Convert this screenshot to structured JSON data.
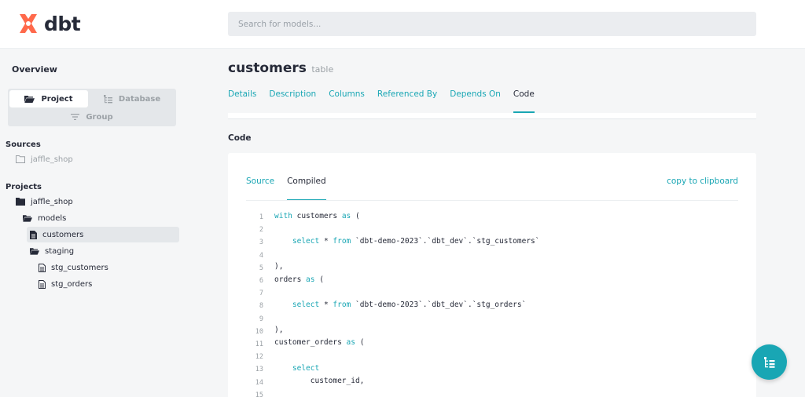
{
  "app": {
    "logo_text": "dbt",
    "brand_color": "#ff694b",
    "accent_color": "#19a6b4"
  },
  "search": {
    "placeholder": "Search for models..."
  },
  "sidebar": {
    "overview": "Overview",
    "switcher": {
      "project": "Project",
      "database": "Database",
      "group": "Group",
      "active": "Project"
    },
    "sources_title": "Sources",
    "sources": [
      {
        "label": "jaffle_shop",
        "icon": "folder-outline-icon"
      }
    ],
    "projects_title": "Projects",
    "projects": [
      {
        "label": "jaffle_shop",
        "icon": "folder-icon"
      },
      {
        "label": "models",
        "icon": "folder-icon"
      },
      {
        "label": "customers",
        "icon": "file-icon",
        "selected": true
      },
      {
        "label": "staging",
        "icon": "folder-icon"
      },
      {
        "label": "stg_customers",
        "icon": "file-outline-icon"
      },
      {
        "label": "stg_orders",
        "icon": "file-outline-icon"
      }
    ]
  },
  "main": {
    "title": "customers",
    "subtitle": "table",
    "tabs": [
      "Details",
      "Description",
      "Columns",
      "Referenced By",
      "Depends On",
      "Code"
    ],
    "active_tab": "Code",
    "code_heading": "Code",
    "code_tabs": [
      "Source",
      "Compiled"
    ],
    "active_code_tab": "Compiled",
    "copy_label": "copy to clipboard",
    "code_lines": [
      {
        "n": "1",
        "parts": [
          [
            "kw",
            "with"
          ],
          [
            "tx",
            " customers "
          ],
          [
            "kw",
            "as"
          ],
          [
            "tx",
            " ("
          ]
        ]
      },
      {
        "n": "2",
        "parts": []
      },
      {
        "n": "3",
        "parts": [
          [
            "tx",
            "    "
          ],
          [
            "kw",
            "select"
          ],
          [
            "tx",
            " * "
          ],
          [
            "kw",
            "from"
          ],
          [
            "tx",
            " `dbt-demo-2023`.`dbt_dev`.`stg_customers`"
          ]
        ]
      },
      {
        "n": "4",
        "parts": []
      },
      {
        "n": "5",
        "parts": [
          [
            "tx",
            "),"
          ]
        ]
      },
      {
        "n": "6",
        "parts": [
          [
            "tx",
            "orders "
          ],
          [
            "kw",
            "as"
          ],
          [
            "tx",
            " ("
          ]
        ]
      },
      {
        "n": "7",
        "parts": []
      },
      {
        "n": "8",
        "parts": [
          [
            "tx",
            "    "
          ],
          [
            "kw",
            "select"
          ],
          [
            "tx",
            " * "
          ],
          [
            "kw",
            "from"
          ],
          [
            "tx",
            " `dbt-demo-2023`.`dbt_dev`.`stg_orders`"
          ]
        ]
      },
      {
        "n": "9",
        "parts": []
      },
      {
        "n": "10",
        "parts": [
          [
            "tx",
            "),"
          ]
        ]
      },
      {
        "n": "11",
        "parts": [
          [
            "tx",
            "customer_orders "
          ],
          [
            "kw",
            "as"
          ],
          [
            "tx",
            " ("
          ]
        ]
      },
      {
        "n": "12",
        "parts": []
      },
      {
        "n": "13",
        "parts": [
          [
            "tx",
            "    "
          ],
          [
            "kw",
            "select"
          ]
        ]
      },
      {
        "n": "14",
        "parts": [
          [
            "tx",
            "        customer_id,"
          ]
        ]
      },
      {
        "n": "15",
        "parts": []
      }
    ]
  },
  "fab": {
    "icon": "lineage-graph-icon"
  }
}
